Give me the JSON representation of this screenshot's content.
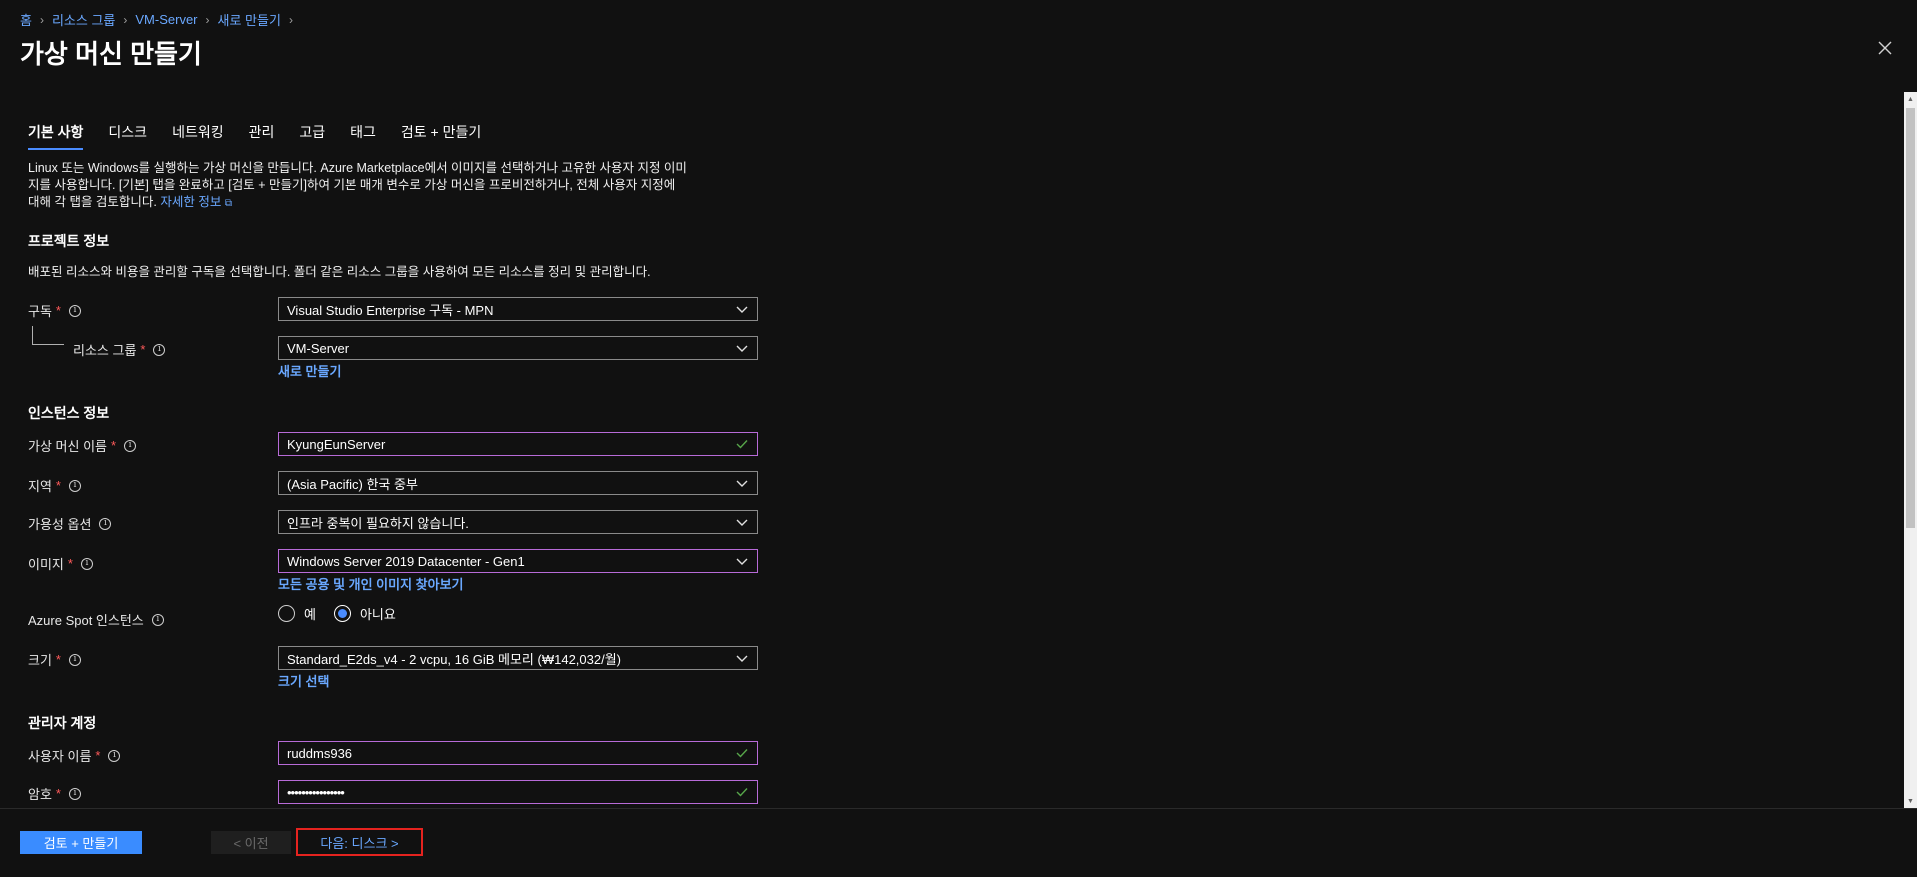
{
  "breadcrumb": [
    "홈",
    "리소스 그룹",
    "VM-Server",
    "새로 만들기"
  ],
  "title": "가상 머신 만들기",
  "tabs": [
    "기본 사항",
    "디스크",
    "네트워킹",
    "관리",
    "고급",
    "태그",
    "검토 + 만들기"
  ],
  "intro": {
    "line1": "Linux 또는 Windows를 실행하는 가상 머신을 만듭니다. Azure Marketplace에서 이미지를 선택하거나 고유한 사용자 지정 이미",
    "line2": "지를 사용합니다. [기본] 탭을 완료하고 [검토 + 만들기]하여 기본 매개 변수로 가상 머신을 프로비전하거나, 전체 사용자 지정에",
    "line3": "대해 각 탭을 검토합니다.",
    "link": "자세한 정보"
  },
  "project": {
    "title": "프로젝트 정보",
    "desc": "배포된 리소스와 비용을 관리할 구독을 선택합니다. 폴더 같은 리소스 그룹을 사용하여 모든 리소스를 정리 및 관리합니다.",
    "subscription_label": "구독",
    "subscription_value": "Visual Studio Enterprise 구독 - MPN",
    "rg_label": "리소스 그룹",
    "rg_value": "VM-Server",
    "rg_create": "새로 만들기"
  },
  "instance": {
    "title": "인스턴스 정보",
    "vmname_label": "가상 머신 이름",
    "vmname_value": "KyungEunServer",
    "region_label": "지역",
    "region_value": "(Asia Pacific) 한국 중부",
    "avail_label": "가용성 옵션",
    "avail_value": "인프라 중복이 필요하지 않습니다.",
    "image_label": "이미지",
    "image_value": "Windows Server 2019 Datacenter - Gen1",
    "image_link": "모든 공용 및 개인 이미지 찾아보기",
    "spot_label": "Azure Spot 인스턴스",
    "spot_yes": "예",
    "spot_no": "아니요",
    "size_label": "크기",
    "size_value": "Standard_E2ds_v4 - 2 vcpu, 16 GiB 메모리 (₩142,032/월)",
    "size_link": "크기 선택"
  },
  "admin": {
    "title": "관리자 계정",
    "user_label": "사용자 이름",
    "user_value": "ruddms936",
    "pw_label": "암호",
    "pw_value": "••••••••••••••••"
  },
  "required_mark": "*",
  "info_glyph": "i",
  "footer": {
    "review_create": "검토 + 만들기",
    "prev": "< 이전",
    "next": "다음: 디스크 >"
  },
  "colors": {
    "accent": "#3a8cff",
    "link": "#6aa8ff",
    "valid_border": "#b86bd8",
    "highlight": "#e5231f",
    "required": "#ff5a5a"
  }
}
